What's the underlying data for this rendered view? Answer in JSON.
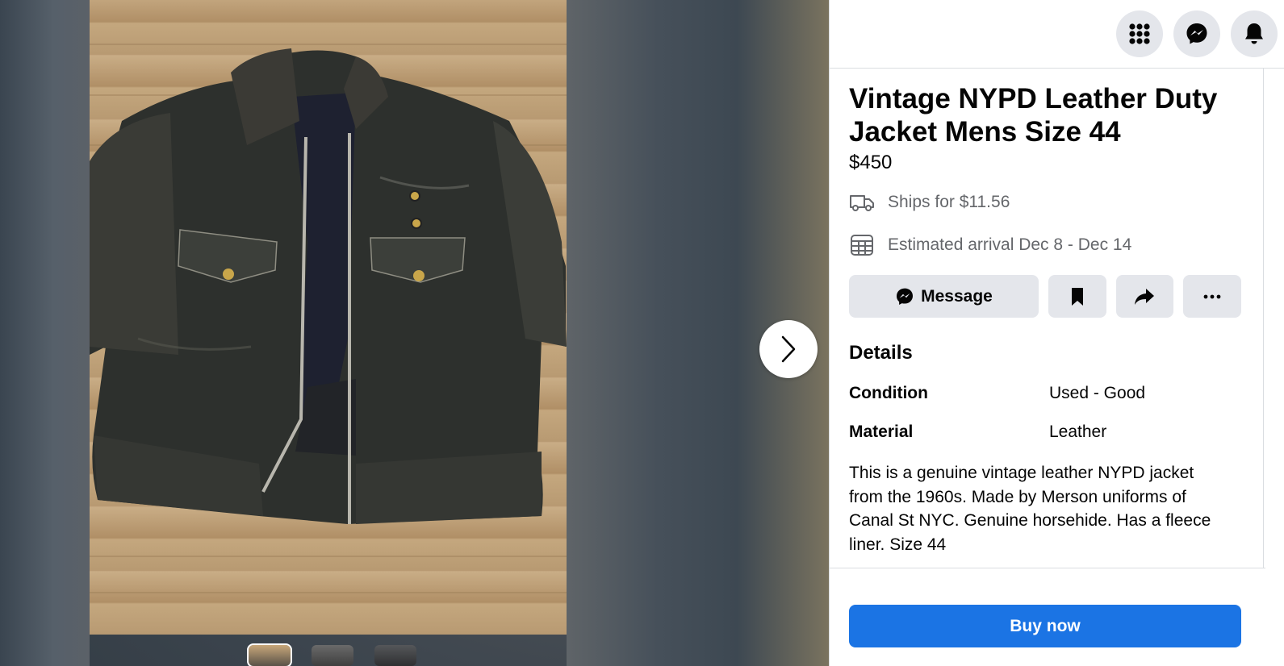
{
  "listing": {
    "title": "Vintage NYPD Leather Duty Jacket Mens Size 44",
    "price": "$450",
    "shipping": "Ships for $11.56",
    "arrival": "Estimated arrival Dec 8 - Dec 14"
  },
  "actions": {
    "message_label": "Message",
    "buy_label": "Buy now"
  },
  "details": {
    "heading": "Details",
    "rows": [
      {
        "key": "Condition",
        "value": "Used - Good"
      },
      {
        "key": "Material",
        "value": "Leather"
      }
    ],
    "description": "This is a genuine vintage leather NYPD jacket from the 1960s. Made by Merson uniforms of Canal St NYC. Genuine horsehide. Has a fleece liner. Size 44"
  },
  "topbar_icons": [
    "menu-grid-icon",
    "messenger-icon",
    "notifications-bell-icon"
  ],
  "colors": {
    "accent": "#1b74e4",
    "button_gray": "#e4e6eb",
    "secondary_text": "#65676b"
  }
}
